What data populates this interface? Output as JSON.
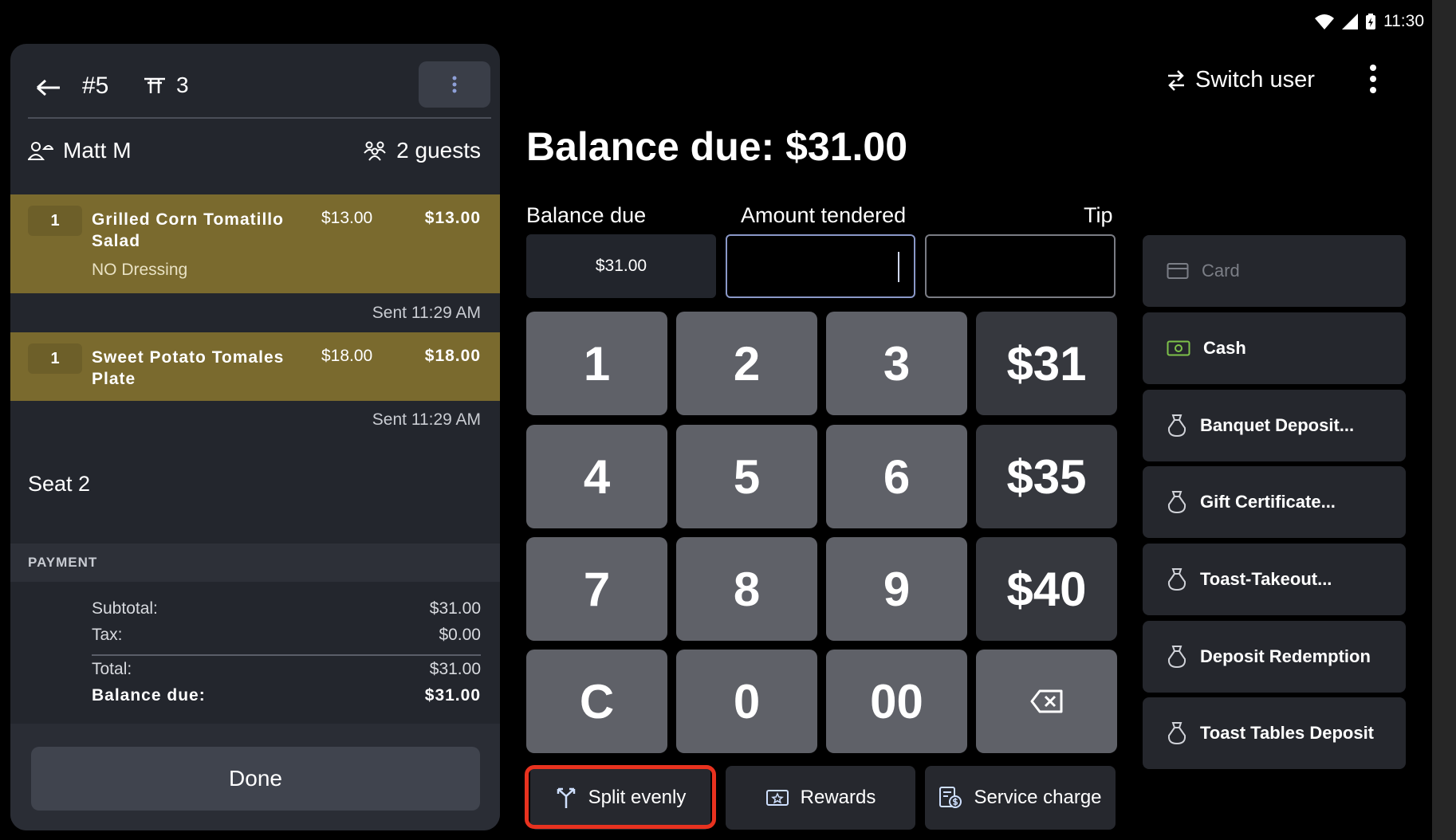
{
  "status_bar": {
    "time": "11:30"
  },
  "order": {
    "number": "#5",
    "table": "3",
    "server": "Matt M",
    "guests": "2 guests"
  },
  "items": [
    {
      "qty": "1",
      "name": "Grilled Corn Tomatillo Salad",
      "price": "$13.00",
      "total": "$13.00",
      "modifier": "NO Dressing",
      "sent": "Sent 11:29 AM"
    },
    {
      "qty": "1",
      "name": "Sweet Potato Tomales Plate",
      "price": "$18.00",
      "total": "$18.00",
      "modifier": "",
      "sent": "Sent 11:29 AM"
    }
  ],
  "seat_label": "Seat 2",
  "payment": {
    "header": "PAYMENT",
    "subtotal_label": "Subtotal:",
    "subtotal": "$31.00",
    "tax_label": "Tax:",
    "tax": "$0.00",
    "total_label": "Total:",
    "total": "$31.00",
    "balance_label": "Balance due:",
    "balance": "$31.00"
  },
  "done_label": "Done",
  "topbar": {
    "switch_user": "Switch user"
  },
  "balance_title": "Balance due: $31.00",
  "fields": {
    "balance_label": "Balance due",
    "balance_value": "$31.00",
    "tendered_label": "Amount tendered",
    "tendered_value": "",
    "tip_label": "Tip",
    "tip_value": ""
  },
  "keypad": {
    "digits": [
      "1",
      "2",
      "3",
      "4",
      "5",
      "6",
      "7",
      "8",
      "9",
      "C",
      "0",
      "00"
    ],
    "quick": [
      "$31",
      "$35",
      "$40"
    ]
  },
  "bottom_buttons": {
    "split": "Split evenly",
    "rewards": "Rewards",
    "service": "Service charge"
  },
  "payment_methods": [
    {
      "label": "Card",
      "icon": "card-icon",
      "enabled": false
    },
    {
      "label": "Cash",
      "icon": "cash-icon",
      "enabled": true
    },
    {
      "label": "Banquet Deposit...",
      "icon": "bag-icon",
      "enabled": true
    },
    {
      "label": "Gift Certificate...",
      "icon": "bag-icon",
      "enabled": true
    },
    {
      "label": "Toast-Takeout...",
      "icon": "bag-icon",
      "enabled": true
    },
    {
      "label": "Deposit Redemption",
      "icon": "bag-icon",
      "enabled": true
    },
    {
      "label": "Toast Tables Deposit",
      "icon": "bag-icon",
      "enabled": true
    }
  ],
  "colors": {
    "item_highlight": "#7a6a2e",
    "accent_outline": "#e8321f",
    "cash_green": "#7ec24a"
  }
}
